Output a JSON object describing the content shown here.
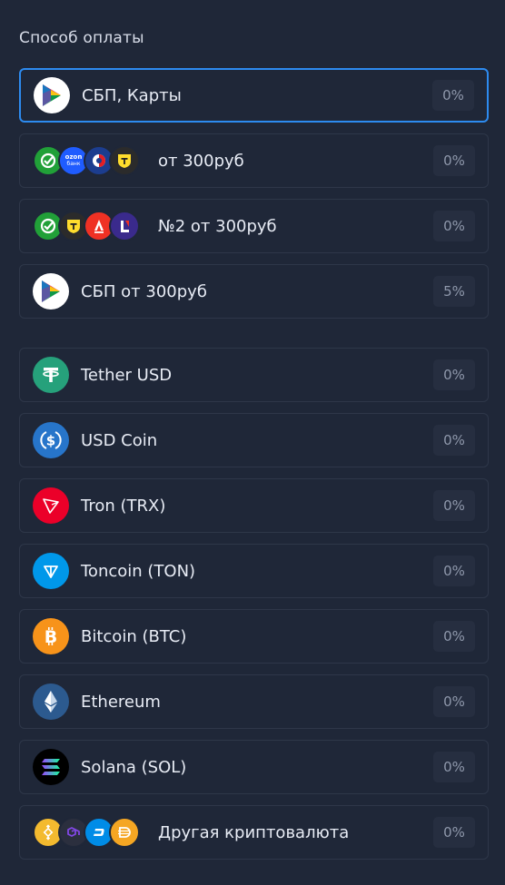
{
  "title": "Способ оплаты",
  "fiat": [
    {
      "label": "СБП, Карты",
      "pct": "0%"
    },
    {
      "label": "от 300руб",
      "pct": "0%"
    },
    {
      "label": "№2 от 300руб",
      "pct": "0%"
    },
    {
      "label": "СБП от 300руб",
      "pct": "5%"
    }
  ],
  "crypto": [
    {
      "label": "Tether USD",
      "pct": "0%"
    },
    {
      "label": "USD Coin",
      "pct": "0%"
    },
    {
      "label": "Tron (TRX)",
      "pct": "0%"
    },
    {
      "label": "Toncoin (TON)",
      "pct": "0%"
    },
    {
      "label": "Bitcoin (BTC)",
      "pct": "0%"
    },
    {
      "label": "Ethereum",
      "pct": "0%"
    },
    {
      "label": "Solana (SOL)",
      "pct": "0%"
    },
    {
      "label": "Другая криптовалюта",
      "pct": "0%"
    }
  ],
  "bank_logos": {
    "ozon": "ozon",
    "ozon_sub": "банк"
  },
  "colors": {
    "accent": "#2d8bf0",
    "background": "#1f2738",
    "border": "#2e3749"
  }
}
